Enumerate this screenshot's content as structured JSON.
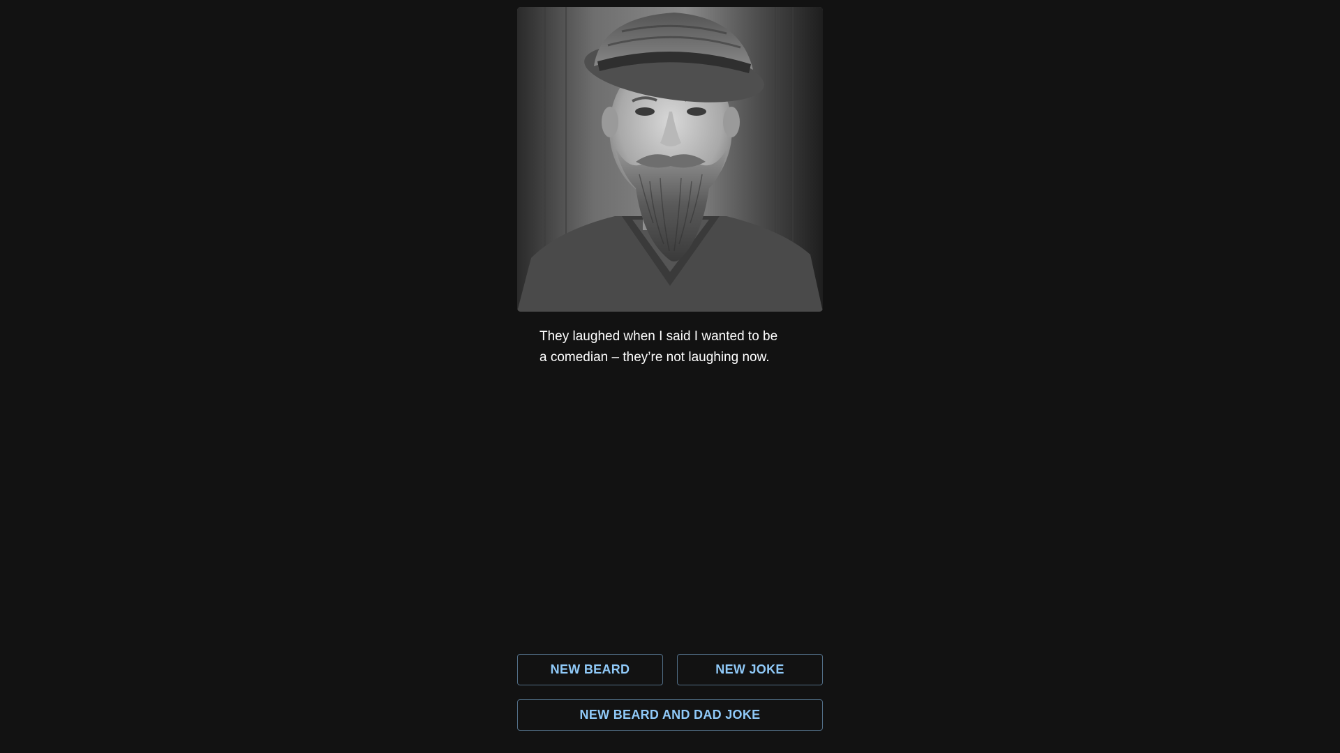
{
  "photo": {
    "subject": "black-and-white portrait of a bearded man wearing a hat"
  },
  "joke": {
    "line1": "They laughed when I said I wanted to be",
    "line2": "a comedian – they’re not laughing now."
  },
  "buttons": {
    "new_beard": "NEW BEARD",
    "new_joke": "NEW JOKE",
    "new_beard_and_joke": "NEW BEARD AND DAD JOKE"
  },
  "colors": {
    "background": "#121212",
    "button_text": "#90caf9",
    "joke_text": "#ffffff"
  }
}
